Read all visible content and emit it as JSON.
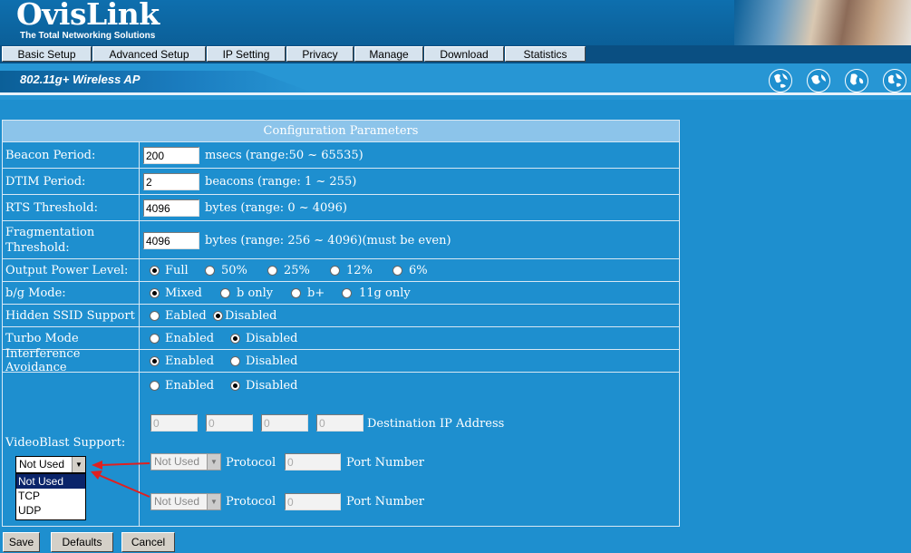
{
  "header": {
    "logo": "OvisLink",
    "tagline": "The Total Networking Solutions"
  },
  "menu": [
    "Basic Setup",
    "Advanced Setup",
    "IP Setting",
    "Privacy",
    "Manage",
    "Download",
    "Statistics"
  ],
  "banner": {
    "product": "802.11g+ Wireless AP",
    "icons": [
      "globe-icon",
      "globe-icon",
      "globe-icon",
      "globe-icon"
    ]
  },
  "config": {
    "title": "Configuration Parameters",
    "beacon": {
      "label": "Beacon Period:",
      "value": "200",
      "hint": "msecs (range:50 ~ 65535)"
    },
    "dtim": {
      "label": "DTIM Period:",
      "value": "2",
      "hint": "beacons (range: 1 ~ 255)"
    },
    "rts": {
      "label": "RTS Threshold:",
      "value": "4096",
      "hint": "bytes (range: 0 ~ 4096)"
    },
    "frag": {
      "label": "Fragmentation Threshold:",
      "value": "4096",
      "hint": "bytes (range: 256 ~ 4096)(must be even)"
    },
    "power": {
      "label": "Output Power Level:",
      "options": [
        "Full",
        "50%",
        "25%",
        "12%",
        "6%"
      ],
      "selected": "Full"
    },
    "bg": {
      "label": "b/g Mode:",
      "options": [
        "Mixed",
        "b only",
        "b+",
        "11g only"
      ],
      "selected": "Mixed"
    },
    "ssid": {
      "label": "Hidden SSID Support",
      "options": [
        "Eabled",
        "Disabled"
      ],
      "selected": "Disabled"
    },
    "turbo": {
      "label": "Turbo Mode",
      "options": [
        "Enabled",
        "Disabled"
      ],
      "selected": "Disabled"
    },
    "interf": {
      "label": "Interference Avoidance",
      "options": [
        "Enabled",
        "Disabled"
      ],
      "selected": "Enabled"
    },
    "videoblast": {
      "label": "VideoBlast Support:",
      "options": [
        "Enabled",
        "Disabled"
      ],
      "selected": "Disabled",
      "ip": [
        "0",
        "0",
        "0",
        "0"
      ],
      "ip_label": "Destination IP Address",
      "protocol_label": "Protocol",
      "port_label": "Port Number",
      "rows": [
        {
          "protocol": "Not Used",
          "port": "0"
        },
        {
          "protocol": "Not Used",
          "port": "0"
        }
      ],
      "dropdown": {
        "value": "Not Used",
        "options": [
          "Not Used",
          "TCP",
          "UDP"
        ],
        "highlighted": "Not Used"
      }
    }
  },
  "buttons": {
    "save": "Save",
    "defaults": "Defaults",
    "cancel": "Cancel"
  },
  "colors": {
    "background": "#1e8fcf",
    "annotation_arrow": "#e02020",
    "table_header": "#8cc4ea"
  }
}
